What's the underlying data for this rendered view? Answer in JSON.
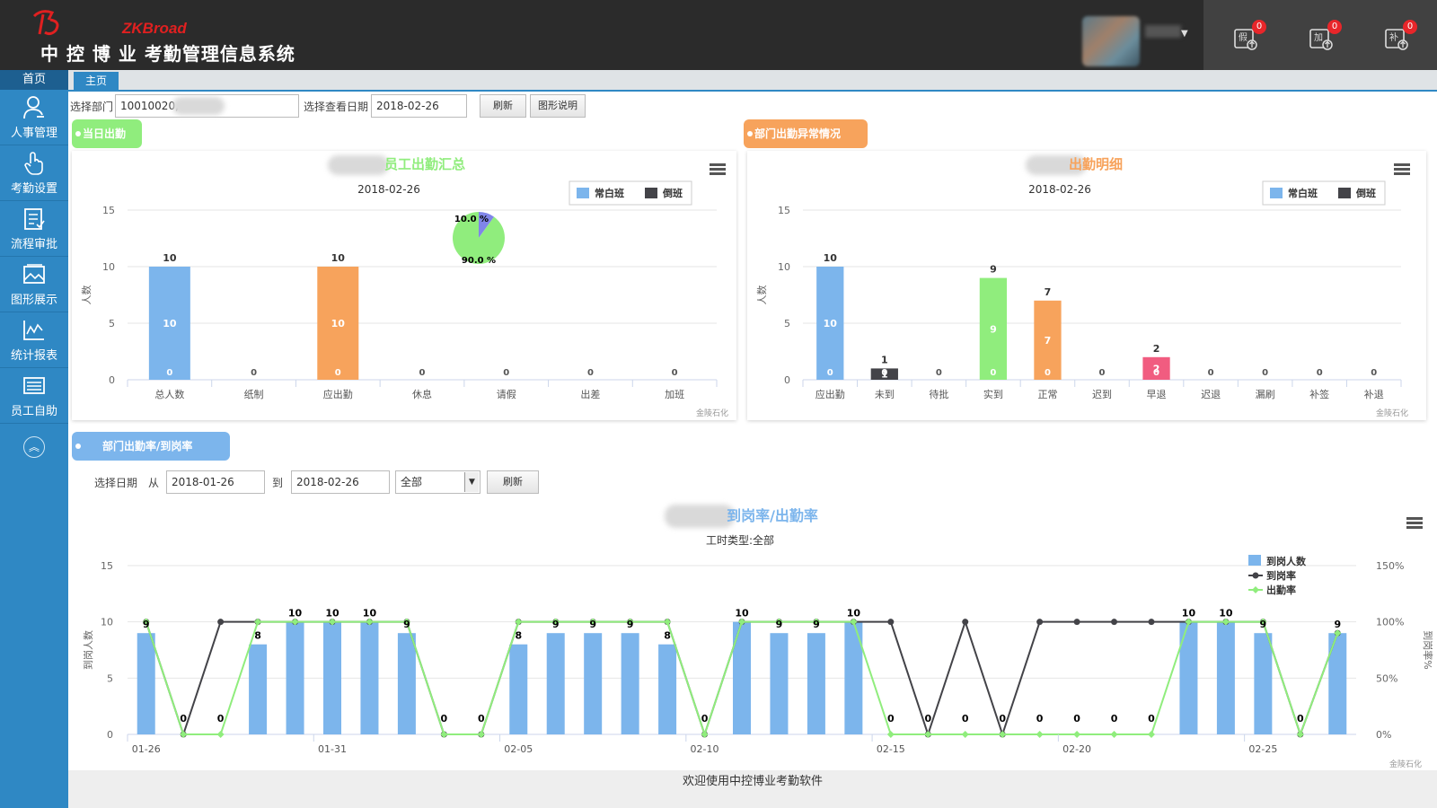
{
  "header": {
    "brand": "ZKBroad",
    "title": "中 控 博 业  考勤管理信息系统",
    "badges": {
      "leave": "0",
      "overtime": "0",
      "supplement": "0"
    },
    "icons": {
      "leave": "假",
      "overtime": "加",
      "supplement": "补"
    }
  },
  "nav": {
    "home": "首页",
    "items": [
      {
        "label": "人事管理",
        "icon": "person-icon"
      },
      {
        "label": "考勤设置",
        "icon": "touch-icon"
      },
      {
        "label": "流程审批",
        "icon": "document-icon"
      },
      {
        "label": "图形展示",
        "icon": "image-icon"
      },
      {
        "label": "统计报表",
        "icon": "line-chart-icon"
      },
      {
        "label": "员工自助",
        "icon": "list-icon"
      }
    ],
    "up": "︽"
  },
  "tabs": {
    "main": "主页"
  },
  "filter": {
    "dept_label": "选择部门",
    "dept_value": "10010020,",
    "date_label": "选择查看日期",
    "date_value": "2018-02-26",
    "refresh": "刷新",
    "explain": "图形说明"
  },
  "section_today": "当日出勤",
  "section_abnormal": "部门出勤异常情况",
  "section_rate": "部门出勤率/到岗率",
  "rate_filter": {
    "date_label": "选择日期",
    "from": "从",
    "from_value": "2018-01-26",
    "to": "到",
    "to_value": "2018-02-26",
    "type_value": "全部",
    "refresh": "刷新"
  },
  "credits": "金陵石化",
  "footer": "欢迎使用中控博业考勤软件",
  "chart_data": [
    {
      "type": "bar",
      "title": "员工出勤汇总",
      "subtitle": "2018-02-26",
      "ylabel": "人数",
      "ylim": [
        0,
        15
      ],
      "yticks": [
        0,
        5,
        10,
        15
      ],
      "categories": [
        "总人数",
        "纸制",
        "应出勤",
        "休息",
        "请假",
        "出差",
        "加班"
      ],
      "bar_colors": [
        "#7cb5ec",
        "#7cb5ec",
        "#f7a35c",
        "#7cb5ec",
        "#7cb5ec",
        "#7cb5ec",
        "#7cb5ec"
      ],
      "series": [
        {
          "name": "常白班",
          "color": "#7cb5ec",
          "values": [
            10,
            0,
            10,
            0,
            0,
            0,
            0
          ]
        },
        {
          "name": "倒班",
          "color": "#434348",
          "values": [
            0,
            0,
            0,
            0,
            0,
            0,
            0
          ]
        }
      ],
      "totals": [
        10,
        0,
        10,
        0,
        0,
        0,
        0
      ],
      "legend": "top-right",
      "pie": {
        "slices": [
          {
            "label": "10.0 %",
            "value": 10.0,
            "color": "#8085e9"
          },
          {
            "label": "90.0 %",
            "value": 90.0,
            "color": "#90ed7d"
          }
        ]
      }
    },
    {
      "type": "bar",
      "title": "出勤明细",
      "subtitle": "2018-02-26",
      "ylabel": "人数",
      "ylim": [
        0,
        15
      ],
      "yticks": [
        0,
        5,
        10,
        15
      ],
      "categories": [
        "应出勤",
        "未到",
        "待批",
        "实到",
        "正常",
        "迟到",
        "早退",
        "迟退",
        "漏刷",
        "补签",
        "补退"
      ],
      "bar_colors": [
        "#7cb5ec",
        "#434348",
        "#7cb5ec",
        "#90ed7d",
        "#f7a35c",
        "#7cb5ec",
        "#f15c80",
        "#7cb5ec",
        "#7cb5ec",
        "#7cb5ec",
        "#7cb5ec"
      ],
      "series": [
        {
          "name": "常白班",
          "color": "#7cb5ec",
          "values": [
            10,
            1,
            0,
            9,
            7,
            0,
            2,
            0,
            0,
            0,
            0
          ]
        },
        {
          "name": "倒班",
          "color": "#434348",
          "values": [
            0,
            0,
            0,
            0,
            0,
            0,
            0,
            0,
            0,
            0,
            0
          ]
        }
      ],
      "totals": [
        10,
        1,
        0,
        9,
        7,
        0,
        2,
        0,
        0,
        0,
        0
      ],
      "legend": "top-right"
    },
    {
      "type": "bar",
      "title": "到岗率/出勤率",
      "subtitle": "工时类型:全部",
      "ylabel": "到岗人数",
      "y2label": "到岗率%",
      "ylim": [
        0,
        15
      ],
      "yticks": [
        0,
        5,
        10,
        15
      ],
      "y2ticks": [
        "0%",
        "50%",
        "100%",
        "150%"
      ],
      "x": [
        "01-26",
        "01-27",
        "01-28",
        "01-29",
        "01-30",
        "01-31",
        "02-01",
        "02-02",
        "02-03",
        "02-04",
        "02-05",
        "02-06",
        "02-07",
        "02-08",
        "02-09",
        "02-10",
        "02-11",
        "02-12",
        "02-13",
        "02-14",
        "02-15",
        "02-16",
        "02-17",
        "02-18",
        "02-19",
        "02-20",
        "02-21",
        "02-22",
        "02-23",
        "02-24",
        "02-25",
        "02-26"
      ],
      "xticks": [
        "01-26",
        "01-31",
        "02-05",
        "02-10",
        "02-15",
        "02-20",
        "02-25"
      ],
      "series": [
        {
          "name": "到岗人数",
          "type": "bar",
          "color": "#7cb5ec",
          "values": [
            9,
            0,
            0,
            8,
            10,
            10,
            10,
            9,
            0,
            0,
            8,
            9,
            9,
            9,
            8,
            0,
            10,
            9,
            9,
            10,
            0,
            0,
            0,
            0,
            0,
            0,
            0,
            0,
            10,
            10,
            9,
            0,
            9
          ]
        },
        {
          "name": "到岗率",
          "type": "line",
          "color": "#434348",
          "values": [
            100,
            0,
            100,
            100,
            100,
            100,
            100,
            100,
            0,
            0,
            100,
            100,
            100,
            100,
            100,
            0,
            100,
            100,
            100,
            100,
            100,
            0,
            100,
            0,
            100,
            100,
            100,
            100,
            100,
            100,
            100,
            0,
            90
          ]
        },
        {
          "name": "出勤率",
          "type": "line",
          "color": "#90ed7d",
          "values": [
            100,
            0,
            0,
            100,
            100,
            100,
            100,
            100,
            0,
            0,
            100,
            100,
            100,
            100,
            100,
            0,
            100,
            100,
            100,
            100,
            0,
            0,
            0,
            0,
            0,
            0,
            0,
            0,
            100,
            100,
            100,
            0,
            90
          ]
        }
      ],
      "legend": "top-right"
    }
  ]
}
